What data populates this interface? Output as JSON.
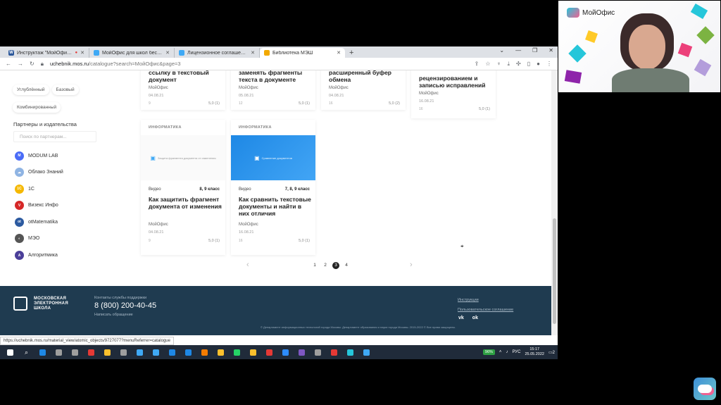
{
  "browser": {
    "tabs": [
      {
        "title": "Инструктаж \"МойОфис Об...",
        "favicon": "W",
        "color": "#2b579a",
        "recording": true
      },
      {
        "title": "МойОфис для школ бесплатно...",
        "favicon": "",
        "color": "#3fa9f5"
      },
      {
        "title": "Лицензионное соглашение с ...",
        "favicon": "",
        "color": "#3fa9f5"
      },
      {
        "title": "Библиотека МЭШ",
        "favicon": "",
        "color": "#f2a900",
        "active": true
      }
    ],
    "new_tab": "+",
    "window_controls": [
      "⌄",
      "—",
      "❐",
      "✕"
    ],
    "url_host": "uchebnik.mos.ru",
    "url_path": "/catalogue?search=МойОфис&page=3"
  },
  "sidebar": {
    "chips": [
      "Углублённый",
      "Базовый",
      "Комбинированный"
    ],
    "partners_title": "Партнеры и издательства",
    "partners_search_placeholder": "Поиск по партнерам...",
    "partners": [
      {
        "name": "MODUM LAB",
        "color": "#4a6cf7",
        "glyph": "M"
      },
      {
        "name": "Облако Знаний",
        "color": "#8fb4e3",
        "glyph": "☁"
      },
      {
        "name": "1С",
        "color": "#f5b800",
        "glyph": "1С"
      },
      {
        "name": "Визекс Инфо",
        "color": "#d62828",
        "glyph": "V"
      },
      {
        "name": "otMatematika",
        "color": "#2c5aa0",
        "glyph": "ot"
      },
      {
        "name": "МЭО",
        "color": "#555555",
        "glyph": "◐"
      },
      {
        "name": "Алгоритмика",
        "color": "#4b3f99",
        "glyph": "A"
      }
    ]
  },
  "cards_top": [
    {
      "title": "ссылку в текстовый документ",
      "author": "МойОфис",
      "date": "04.08.21",
      "views": "9",
      "rating": "5,0 (1)"
    },
    {
      "title": "заменять фрагменты текста в документе",
      "author": "МойОфис",
      "date": "05.08.21",
      "views": "12",
      "rating": "5,0 (1)"
    },
    {
      "title": "расширенный буфер обмена",
      "author": "МойОфис",
      "date": "04.08.21",
      "views": "16",
      "rating": "5,0 (2)"
    },
    {
      "title": "рецензированием и записью исправлений",
      "author": "МойОфис",
      "date": "16.08.21",
      "views": "16",
      "rating": "5,0 (1)"
    }
  ],
  "cards_bottom": [
    {
      "subject": "ИНФОРМАТИКА",
      "thumb_text": "Защита фрагмента документа от изменения",
      "type": "Видео",
      "grade": "8, 9 класс",
      "title": "Как защитить фрагмент документа от изменения",
      "author": "МойОфис",
      "date": "04.08.21",
      "views": "9",
      "rating": "5,0 (1)"
    },
    {
      "subject": "ИНФОРМАТИКА",
      "thumb_text": "Сравнение документов",
      "type": "Видео",
      "grade": "7, 8, 9 класс",
      "title": "Как сравнить текстовые документы и найти в них отличия",
      "author": "МойОфис",
      "date": "16.08.21",
      "views": "16",
      "rating": "5,0 (1)"
    }
  ],
  "pagination": {
    "prev": "‹",
    "next": "›",
    "pages": [
      "1",
      "2",
      "3",
      "4"
    ],
    "active": "3"
  },
  "footer": {
    "logo_text": "МОСКОВСКАЯ ЭЛЕКТРОННАЯ ШКОЛА",
    "support_label": "Контакты службы поддержки",
    "phone": "8 (800) 200-40-45",
    "write_link": "Написать обращение",
    "links": [
      "Инструкции",
      "Пользовательское соглашение"
    ],
    "social": [
      "vk",
      "ok"
    ],
    "copyright": "© Департамент информационных технологий города Москвы. Департамент образования и науки города Москвы. 2015-2022 © Все права защищены."
  },
  "status_url": "https://uchebnik.mos.ru/material_view/atomic_objects/9727077?menuReferrer=catalogue",
  "taskbar": {
    "apps": [
      "#1e88e5",
      "#9e9e9e",
      "#9e9e9e",
      "#e53935",
      "#fbc02d",
      "#9e9e9e",
      "#3fa9f5",
      "#3fa9f5",
      "#1e88e5",
      "#1e88e5",
      "#f57c00",
      "#fbc02d",
      "#25d366",
      "#fbc02d",
      "#e53935",
      "#2d8cff",
      "#7e57c2",
      "#9e9e9e",
      "#e53935",
      "#26c6da",
      "#3fa9f5"
    ],
    "battery": "96%",
    "lang": "РУС",
    "time": "15:17",
    "date": "25.05.2022",
    "notif": "2"
  },
  "webcam": {
    "brand": "МойОфис"
  }
}
